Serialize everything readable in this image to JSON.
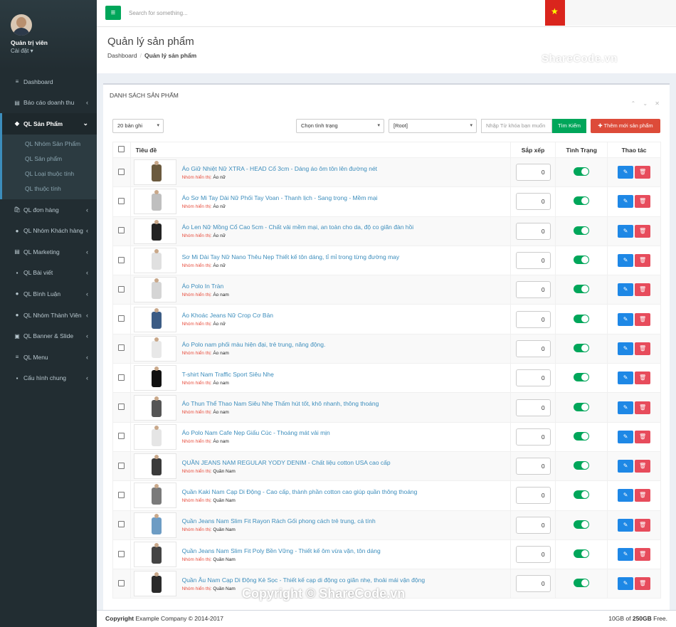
{
  "user": {
    "name": "Quản trị viên",
    "sub": "Cài đặt ▾"
  },
  "menu": [
    {
      "icon": "≡",
      "label": "Dashboard",
      "chev": ""
    },
    {
      "icon": "▤",
      "label": "Báo cáo doanh thu",
      "chev": "‹"
    },
    {
      "icon": "◆",
      "label": "QL Sản Phẩm",
      "chev": "⌄"
    },
    {
      "icon": "🛍",
      "label": "QL đơn hàng",
      "chev": "‹"
    },
    {
      "icon": "●",
      "label": "QL Nhóm Khách hàng",
      "chev": "‹"
    },
    {
      "icon": "▤",
      "label": "QL Marketing",
      "chev": "‹"
    },
    {
      "icon": "▪",
      "label": "QL Bài viết",
      "chev": "‹"
    },
    {
      "icon": "●",
      "label": "QL Bình Luận",
      "chev": "‹"
    },
    {
      "icon": "●",
      "label": "QL Nhóm Thành Viên",
      "chev": "‹"
    },
    {
      "icon": "▣",
      "label": "QL Banner & Slide",
      "chev": "‹"
    },
    {
      "icon": "≡",
      "label": "QL Menu",
      "chev": "‹"
    },
    {
      "icon": "▪",
      "label": "Cấu hình chung",
      "chev": "‹"
    }
  ],
  "submenu": [
    "QL Nhóm Sản Phẩm",
    "QL Sản phẩm",
    "QL Loại thuộc tính",
    "QL thuộc tính"
  ],
  "search_placeholder": "Search for something...",
  "menu_button": "≡",
  "page_title": "Quản lý sản phẩm",
  "breadcrumb": {
    "home": "Dashboard",
    "sep": "/",
    "current": "Quản lý sản phẩm"
  },
  "watermark": "ShareCode.vn",
  "box_title": "DANH SÁCH SẢN PHẨM",
  "box_tools": "⌃ ⌄ ✕",
  "filters": {
    "per_page": "20 bản ghi",
    "status": "Chọn tình trạng",
    "category": "[Root]",
    "keyword_placeholder": "Nhập Từ khóa bạn muốn",
    "search_button": "Tìm Kiếm",
    "add_button": "✚ Thêm mới sản phẩm",
    "caret": "▾"
  },
  "columns": {
    "title": "Tiêu đề",
    "order": "Sắp xếp",
    "status": "Tình Trạng",
    "action": "Thao tác"
  },
  "group_prefix": "Nhóm hiển thị:",
  "edit_icon": "✎",
  "delete_icon": "🗑",
  "rows": [
    {
      "title": "Áo Giữ Nhiệt Nữ XTRA - HEAD Cổ 3cm - Dáng áo ôm tôn lên đường nét",
      "group": "Áo nữ",
      "order": "0",
      "color": "#6b5a3e"
    },
    {
      "title": "Áo Sơ Mi Tay Dài Nữ Phối Tay Voan - Thanh lịch - Sang trọng - Mềm mại",
      "group": "Áo nữ",
      "order": "0",
      "color": "#bfbfbf"
    },
    {
      "title": "Áo Len Nữ Mồng Cổ Cao 5cm - Chất vải mềm mại, an toàn cho da, độ co giãn đàn hồi",
      "group": "Áo nữ",
      "order": "0",
      "color": "#222222"
    },
    {
      "title": "Sơ Mi Dài Tay Nữ Nano Thêu Nẹp Thiết kế tôn dáng, tỉ mỉ trong từng đường may",
      "group": "Áo nữ",
      "order": "0",
      "color": "#e0e0e0"
    },
    {
      "title": "Áo Polo In Tràn",
      "group": "Áo nam",
      "order": "0",
      "color": "#d5d5d5"
    },
    {
      "title": "Áo Khoác Jeans Nữ Crop Cơ Bản",
      "group": "Áo nữ",
      "order": "0",
      "color": "#3c5c85"
    },
    {
      "title": "Áo Polo nam phối màu hiện đại, trẻ trung, năng động.",
      "group": "Áo nam",
      "order": "0",
      "color": "#e8e8e8"
    },
    {
      "title": "T-shirt Nam Traffic Sport Siêu Nhẹ",
      "group": "Áo nam",
      "order": "0",
      "color": "#111111"
    },
    {
      "title": "Áo Thun Thể Thao Nam Siêu Nhẹ Thấm hút tốt, khô nhanh, thông thoáng",
      "group": "Áo nam",
      "order": "0",
      "color": "#555555"
    },
    {
      "title": "Áo Polo Nam Cafe Nẹp Giấu Cúc - Thoáng mát vải mịn",
      "group": "Áo nam",
      "order": "0",
      "color": "#e5e5e5"
    },
    {
      "title": "QUẦN JEANS NAM REGULAR YODY DENIM - Chất liệu cotton USA cao cấp",
      "group": "Quần Nam",
      "order": "0",
      "color": "#3a3a3a"
    },
    {
      "title": "Quần Kaki Nam Cạp Di Động - Cao cấp, thành phần cotton cao giúp quần thông thoáng",
      "group": "Quần Nam",
      "order": "0",
      "color": "#7a7a7a"
    },
    {
      "title": "Quần Jeans Nam Slim Fit Rayon Rách Gối phong cách trẻ trung, cá tính",
      "group": "Quần Nam",
      "order": "0",
      "color": "#6d9cc4"
    },
    {
      "title": "Quần Jeans Nam Slim Fit Poly Bền Vững - Thiết kế ôm vừa vặn, tôn dáng",
      "group": "Quần Nam",
      "order": "0",
      "color": "#444444"
    },
    {
      "title": "Quần Âu Nam Cạp Di Động Kẻ Sọc - Thiết kế cạp di động co giãn nhẹ, thoải mái vận động",
      "group": "Quần Nam",
      "order": "0",
      "color": "#2a2a2a"
    }
  ],
  "footer": {
    "copyright": "Copyright",
    "company": "Example Company © 2014-2017",
    "storage_used": "10GB of",
    "storage_total": "250GB",
    "storage_suffix": "Free."
  },
  "footer_watermark": "Copyright © ShareCode.vn"
}
